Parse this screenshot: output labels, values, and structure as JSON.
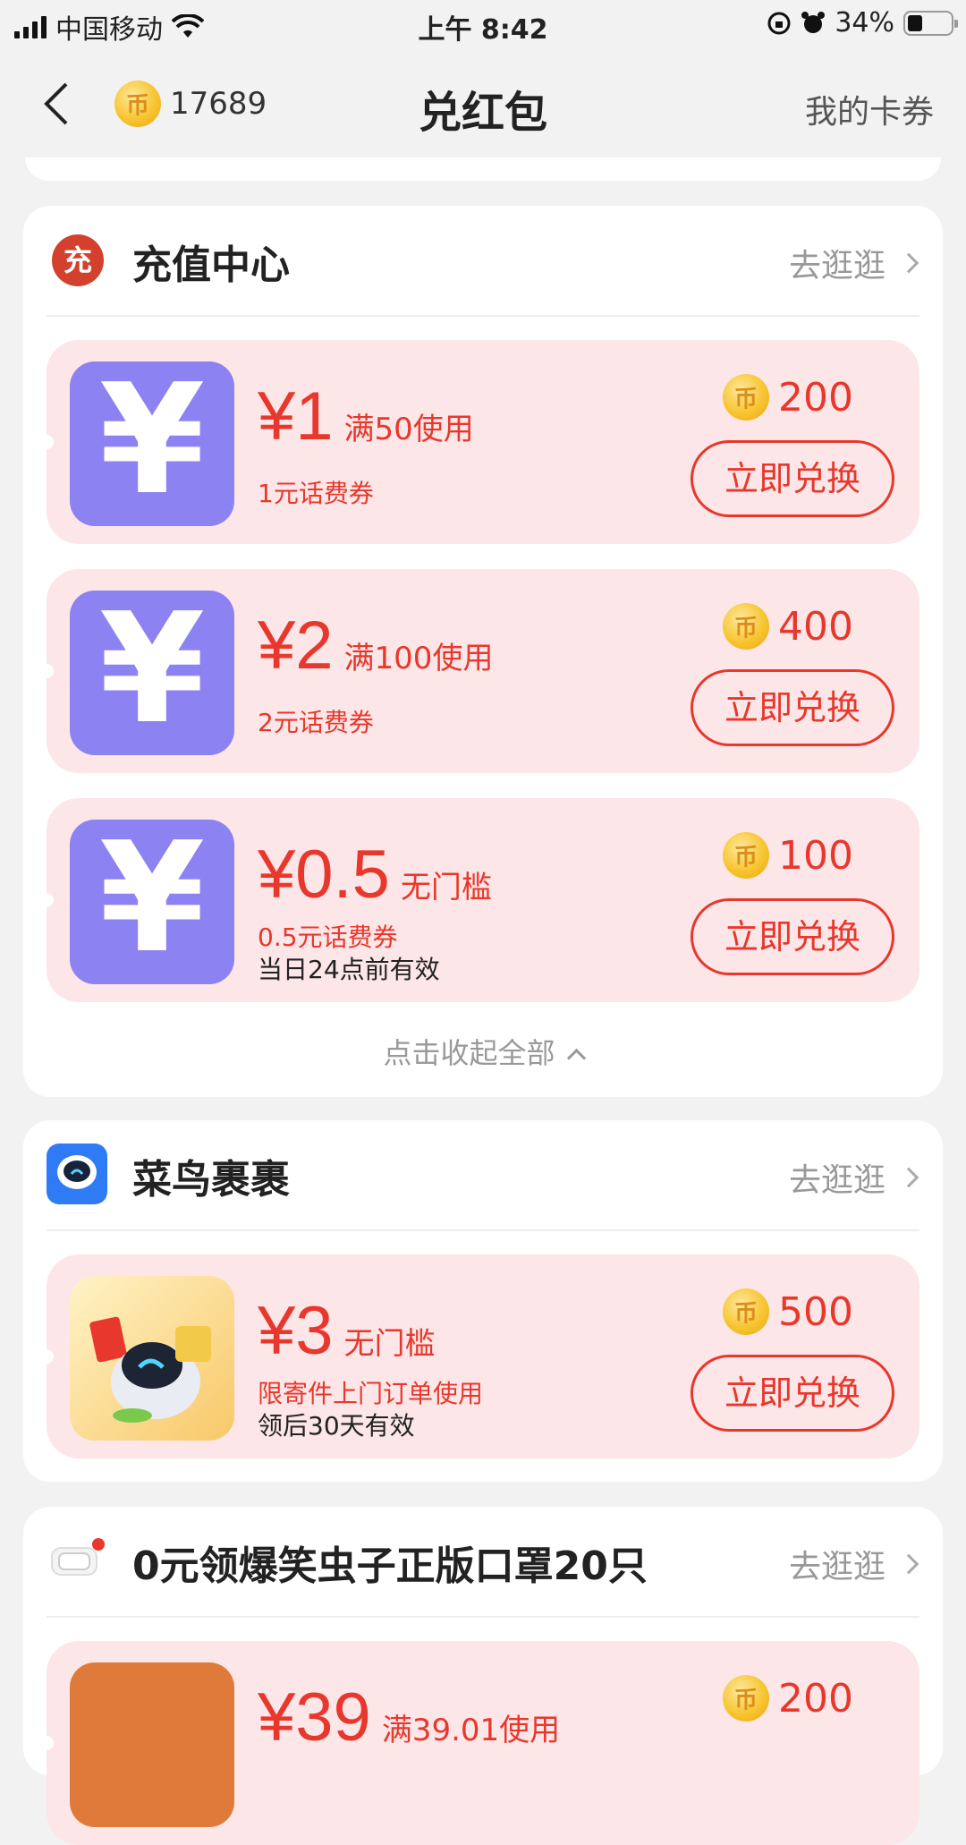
{
  "status_bar": {
    "carrier": "中国移动",
    "time": "上午 8:42",
    "battery": "34%",
    "battery_level": 0.34
  },
  "nav": {
    "title": "兑红包",
    "coin_count": "17689",
    "my_cards": "我的卡券"
  },
  "sections": [
    {
      "icon_text": "充",
      "name": "充值中心",
      "go": "去逛逛",
      "items": [
        {
          "amount": "¥1",
          "condition": "满50使用",
          "desc": "1元话费券",
          "cost": "200",
          "button": "立即兑换"
        },
        {
          "amount": "¥2",
          "condition": "满100使用",
          "desc": "2元话费券",
          "cost": "400",
          "button": "立即兑换"
        },
        {
          "amount": "¥0.5",
          "condition": "无门槛",
          "desc": "0.5元话费券",
          "desc2": "当日24点前有效",
          "cost": "100",
          "button": "立即兑换"
        }
      ],
      "collapse": "点击收起全部"
    },
    {
      "name": "菜鸟裹裹",
      "go": "去逛逛",
      "items": [
        {
          "amount": "¥3",
          "condition": "无门槛",
          "desc": "限寄件上门订单使用",
          "desc2": "领后30天有效",
          "cost": "500",
          "button": "立即兑换"
        }
      ]
    },
    {
      "name": "0元领爆笑虫子正版口罩20只",
      "go": "去逛逛",
      "items": [
        {
          "amount": "¥39",
          "condition": "满39.01使用",
          "cost": "200"
        }
      ]
    }
  ],
  "colors": {
    "accent": "#e8372c",
    "card_bg": "#fce6e7",
    "recharge_icon_bg": "#d3402d",
    "yen_thumb": "#8c82f2",
    "cainiao_blue": "#2f7bf5"
  }
}
